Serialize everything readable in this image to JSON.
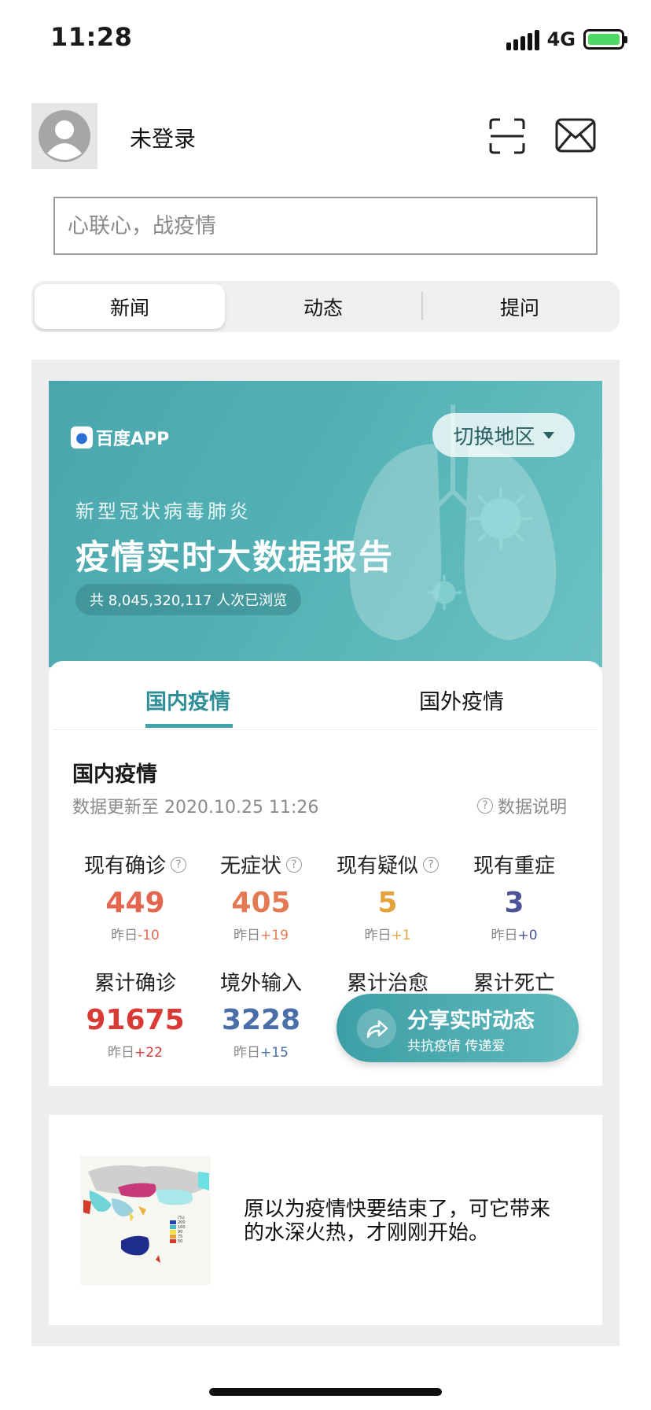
{
  "status_bar": {
    "time": "11:28",
    "network": "4G"
  },
  "header": {
    "login_text": "未登录"
  },
  "search": {
    "placeholder": "心联心，战疫情"
  },
  "segments": [
    "新闻",
    "动态",
    "提问"
  ],
  "banner": {
    "brand": "百度APP",
    "switch_region": "切换地区",
    "subtitle": "新型冠状病毒肺炎",
    "title": "疫情实时大数据报告",
    "views": "共 8,045,320,117 人次已浏览"
  },
  "stats_card": {
    "tabs": [
      "国内疫情",
      "国外疫情"
    ],
    "section_title": "国内疫情",
    "updated": "数据更新至 2020.10.25 11:26",
    "explain": "数据说明",
    "stats": [
      {
        "label": "现有确诊",
        "value": "449",
        "delta_prefix": "昨日",
        "delta": "-10",
        "color": "#e5654f",
        "delta_color": "#e5654f",
        "help": true
      },
      {
        "label": "无症状",
        "value": "405",
        "delta_prefix": "昨日",
        "delta": "+19",
        "color": "#e37a54",
        "delta_color": "#e37a54",
        "help": true
      },
      {
        "label": "现有疑似",
        "value": "5",
        "delta_prefix": "昨日",
        "delta": "+1",
        "color": "#e6a23c",
        "delta_color": "#e6a23c",
        "help": true
      },
      {
        "label": "现有重症",
        "value": "3",
        "delta_prefix": "昨日",
        "delta": "+0",
        "color": "#4b5296",
        "delta_color": "#4b5296",
        "help": false
      },
      {
        "label": "累计确诊",
        "value": "91675",
        "delta_prefix": "昨日",
        "delta": "+22",
        "color": "#d93a35",
        "delta_color": "#d93a35",
        "help": false
      },
      {
        "label": "境外输入",
        "value": "3228",
        "delta_prefix": "昨日",
        "delta": "+15",
        "color": "#4a6fa8",
        "delta_color": "#4a6fa8",
        "help": false
      },
      {
        "label": "累计治愈",
        "value": "",
        "delta_prefix": "",
        "delta": "",
        "color": "#46a58e",
        "delta_color": "#46a58e",
        "help": false
      },
      {
        "label": "累计死亡",
        "value": "",
        "delta_prefix": "",
        "delta": "",
        "color": "#555555",
        "delta_color": "#555555",
        "help": false
      }
    ],
    "share": {
      "title": "分享实时动态",
      "subtitle": "共抗疫情 传递爱"
    }
  },
  "news": {
    "text": "原以为疫情快要结束了，可它带来的水深火热，才刚刚开始。",
    "thumb_legend": [
      "(%)",
      "200",
      "100",
      "90",
      "75",
      "50"
    ]
  },
  "colors": {
    "accent": "#3ea4ab",
    "banner": "#4aa6ad"
  },
  "icons": [
    "avatar-icon",
    "scan-icon",
    "mail-icon",
    "help-icon",
    "share-arrow-icon",
    "caret-down-icon",
    "battery-icon",
    "signal-icon"
  ]
}
